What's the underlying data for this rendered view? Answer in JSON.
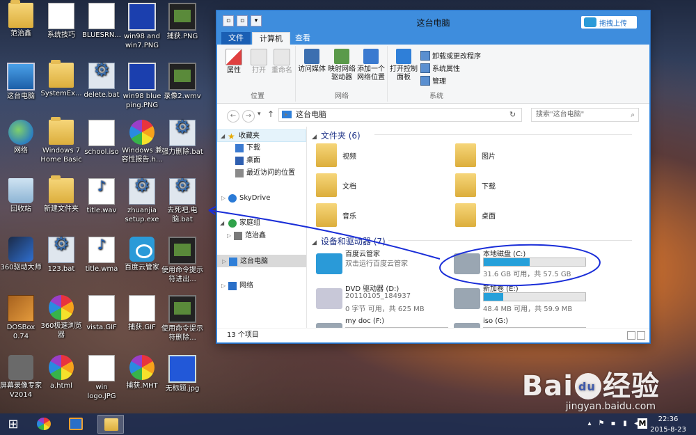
{
  "desktop": {
    "icons": [
      {
        "label": "范治鑫",
        "kind": "folder"
      },
      {
        "label": "系统技巧",
        "kind": "doc"
      },
      {
        "label": "BLUESRN...",
        "kind": "doc"
      },
      {
        "label": "win98 and win7.PNG",
        "kind": "bluewin"
      },
      {
        "label": "捕获.PNG",
        "kind": "film"
      },
      {
        "label": "这台电脑",
        "kind": "pc"
      },
      {
        "label": "SystemEx...",
        "kind": "folder"
      },
      {
        "label": "delete.bat",
        "kind": "gear"
      },
      {
        "label": "win98 blue ping.PNG",
        "kind": "bluewin"
      },
      {
        "label": "录像2.wmv",
        "kind": "film"
      },
      {
        "label": "网络",
        "kind": "globe"
      },
      {
        "label": "Windows 7 Home Basic",
        "kind": "folder"
      },
      {
        "label": "school.iso",
        "kind": "doc"
      },
      {
        "label": "Windows 兼容性报告.h...",
        "kind": "pinwheel"
      },
      {
        "label": "强力删除.bat",
        "kind": "gear"
      },
      {
        "label": "回收站",
        "kind": "bin"
      },
      {
        "label": "新建文件夹",
        "kind": "folder"
      },
      {
        "label": "title.wav",
        "kind": "wav"
      },
      {
        "label": "zhuanjia setup.exe",
        "kind": "gear"
      },
      {
        "label": "去死吧,电脑.bat",
        "kind": "gear"
      },
      {
        "label": "360驱动大师",
        "kind": "kuai"
      },
      {
        "label": "123.bat",
        "kind": "gear"
      },
      {
        "label": "title.wma",
        "kind": "wav"
      },
      {
        "label": "百度云管家",
        "kind": "cloud"
      },
      {
        "label": "使用命令提示符进出...",
        "kind": "film"
      },
      {
        "label": "DOSBox 0.74",
        "kind": "dosbox"
      },
      {
        "label": "360极速浏览器",
        "kind": "pinwheel"
      },
      {
        "label": "vista.GIF",
        "kind": "doc"
      },
      {
        "label": "捕获.GIF",
        "kind": "doc"
      },
      {
        "label": "使用命令提示符删除...",
        "kind": "film"
      },
      {
        "label": "屏幕录像专家V2014",
        "kind": "cam"
      },
      {
        "label": "a.html",
        "kind": "pinwheel"
      },
      {
        "label": "win logo.JPG",
        "kind": "doc"
      },
      {
        "label": "捕获.MHT",
        "kind": "pinwheel"
      },
      {
        "label": "无标题.jpg",
        "kind": "blank"
      }
    ]
  },
  "window": {
    "title": "这台电脑",
    "upload_label": "拖拽上传",
    "tabs": {
      "file": "文件",
      "computer": "计算机",
      "view": "查看"
    },
    "ribbon": {
      "location": {
        "label": "位置",
        "properties": "属性",
        "open": "打开",
        "rename": "重命名"
      },
      "network": {
        "label": "网络",
        "media": "访问媒体",
        "map_drive": "映射网络驱动器",
        "add_location": "添加一个网络位置"
      },
      "system": {
        "label": "系统",
        "control_panel": "打开控制面板",
        "uninstall": "卸载或更改程序",
        "sys_props": "系统属性",
        "manage": "管理"
      }
    },
    "address": {
      "path": "这台电脑",
      "search_placeholder": "搜索\"这台电脑\""
    },
    "nav": {
      "favorites": "收藏夹",
      "downloads": "下载",
      "desktop": "桌面",
      "recent": "最近访问的位置",
      "skydrive": "SkyDrive",
      "homegroup": "家庭组",
      "homegroup_user": "范治鑫",
      "this_pc": "这台电脑",
      "network": "网络"
    },
    "folders_header": "文件夹 (6)",
    "folders": [
      {
        "name": "视频"
      },
      {
        "name": "图片"
      },
      {
        "name": "文档"
      },
      {
        "name": "下载"
      },
      {
        "name": "音乐"
      },
      {
        "name": "桌面"
      }
    ],
    "devices_header": "设备和驱动器 (7)",
    "devices": [
      {
        "name": "百度云管家",
        "sub": "双击运行百度云管家",
        "kind": "cloud"
      },
      {
        "name": "本地磁盘 (C:)",
        "info": "31.6 GB 可用，共 57.5 GB",
        "used_fraction": 0.45,
        "kind": "hdd"
      },
      {
        "name": "DVD 驱动器 (D:)",
        "sub": "20110105_184937",
        "info": "0 字节 可用，共 625 MB",
        "kind": "dvd"
      },
      {
        "name": "新加卷 (E:)",
        "info": "48.4 MB 可用，共 59.9 MB",
        "used_fraction": 0.19,
        "kind": "hdd"
      },
      {
        "name": "my doc (F:)",
        "kind": "hdd"
      },
      {
        "name": "iso (G:)",
        "kind": "hdd"
      }
    ],
    "status": "13 个项目"
  },
  "taskbar": {
    "time": "22:36",
    "date": "2015-8-23",
    "ime": "M"
  },
  "watermark": {
    "brand": "Bai",
    "brand2": "经验",
    "url": "jingyan.baidu.com"
  },
  "colors": {
    "accent": "#3e8ddd",
    "file_tab": "#1a5fb4",
    "drive_fill": "#26a0da",
    "annotation": "#1a2ed8"
  }
}
